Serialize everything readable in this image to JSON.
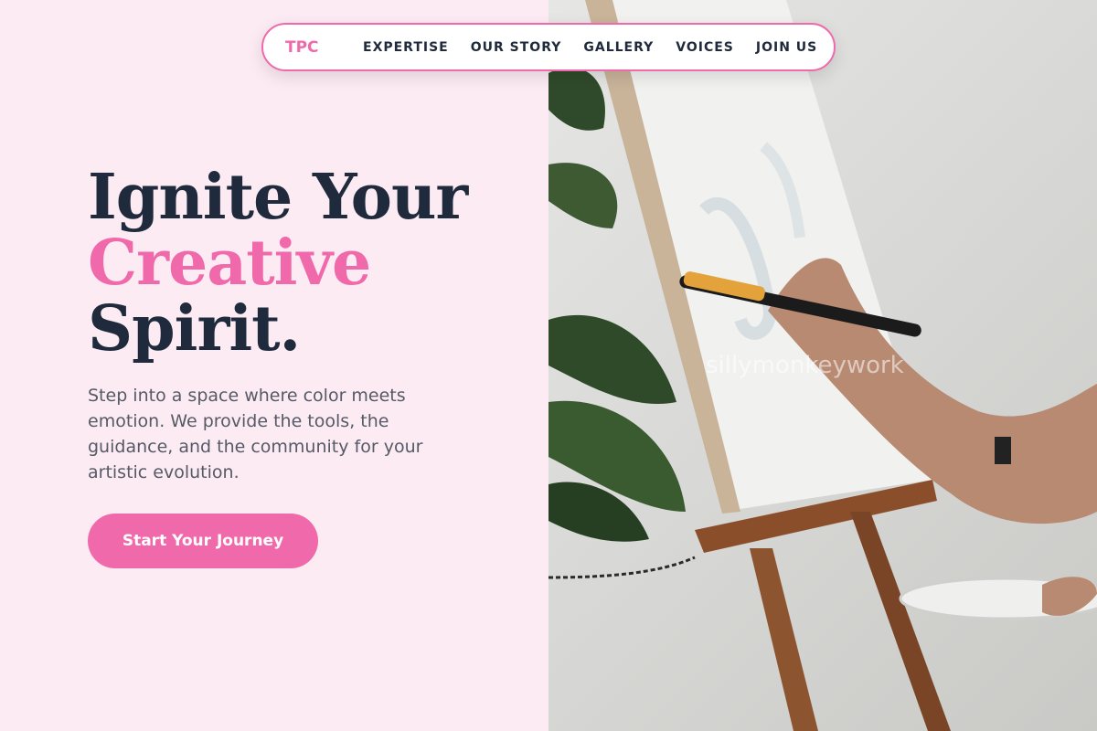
{
  "nav": {
    "brand": "TPC",
    "links": [
      "EXPERTISE",
      "OUR STORY",
      "GALLERY",
      "VOICES",
      "JOIN US"
    ]
  },
  "hero": {
    "title_line1": "Ignite Your",
    "title_line2": "Creative",
    "title_line3": "Spirit.",
    "subtitle": "Step into a space where color meets emotion. We provide the tools, the guidance, and the community for your artistic evolution.",
    "cta_label": "Start Your Journey"
  },
  "image": {
    "subject": "artist-painting-on-easel",
    "watermark": "sillymonkeywork"
  },
  "colors": {
    "accent": "#f06aab",
    "text_dark": "#1f2a3c",
    "background": "#fdebf3"
  }
}
